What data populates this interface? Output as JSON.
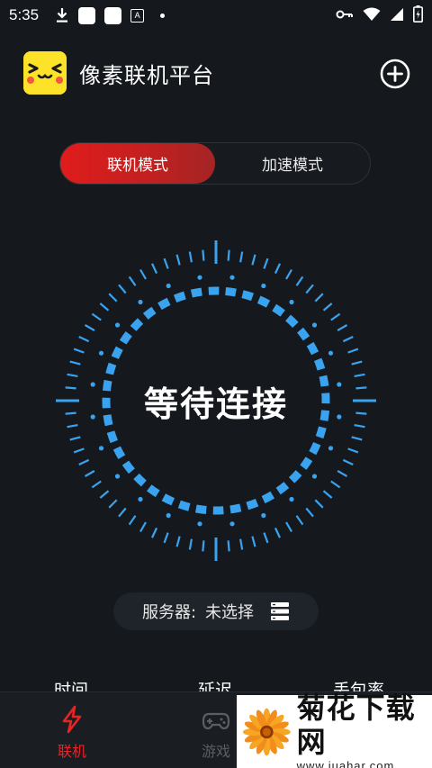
{
  "status_bar": {
    "time": "5:35"
  },
  "header": {
    "title": "像素联机平台"
  },
  "mode_tabs": [
    {
      "label": "联机模式",
      "active": true
    },
    {
      "label": "加速模式",
      "active": false
    }
  ],
  "status": {
    "text": "等待连接"
  },
  "server": {
    "label": "服务器:",
    "value": "未选择"
  },
  "stats": [
    {
      "label": "时间"
    },
    {
      "label": "延迟"
    },
    {
      "label": "丢包率"
    }
  ],
  "bottom_nav": [
    {
      "label": "联机",
      "icon": "lightning-icon",
      "active": true
    },
    {
      "label": "游戏",
      "icon": "gamepad-icon",
      "active": false
    }
  ],
  "watermark": {
    "name": "菊花下载网",
    "url": "www.juahar.com"
  },
  "colors": {
    "accent_red": "#e01c1c",
    "radar_blue": "#3aa3ef",
    "background": "#15191e"
  }
}
